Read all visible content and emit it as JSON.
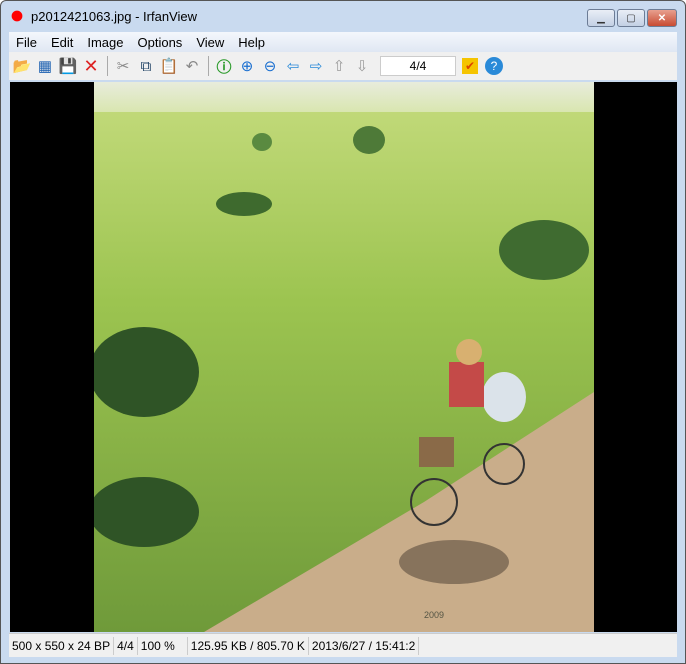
{
  "window": {
    "title": "p2012421063.jpg - IrfanView"
  },
  "menu": [
    "File",
    "Edit",
    "Image",
    "Options",
    "View",
    "Help"
  ],
  "toolbar": {
    "page_value": "4/4"
  },
  "status": {
    "dimensions": "500 x 550 x 24 BP",
    "page": "4/4",
    "zoom": "100 %",
    "size": "125.95 KB / 805.70 K",
    "datetime": "2013/6/27 / 15:41:2"
  },
  "image": {
    "signature": "2009"
  }
}
